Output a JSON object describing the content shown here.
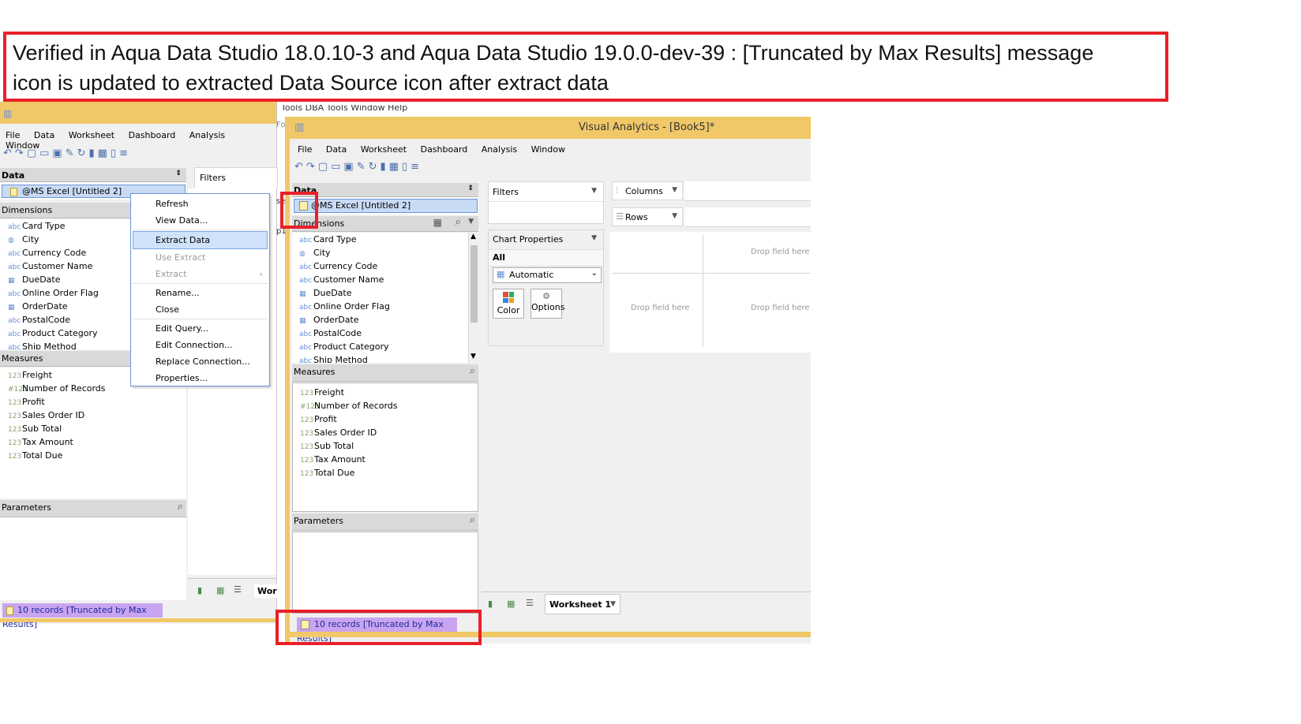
{
  "banner": {
    "line1": "Verified in Aqua Data Studio 18.0.10-3 and Aqua Data Studio 19.0.0-dev-39 : [Truncated by Max Results] message",
    "line2": "icon is updated to extracted Data Source icon after extract data"
  },
  "left_window": {
    "menu": [
      "File",
      "Data",
      "Worksheet",
      "Dashboard",
      "Analysis",
      "Window"
    ],
    "data_header": "Data",
    "datasource": "@MS Excel [Untitled 2]",
    "filters_label": "Filters",
    "dimensions_header": "Dimensions",
    "dimensions": [
      "Card Type",
      "City",
      "Currency Code",
      "Customer Name",
      "DueDate",
      "Online Order Flag",
      "OrderDate",
      "PostalCode",
      "Product Category",
      "Ship Method"
    ],
    "dimension_types": [
      "abc",
      "geo",
      "abc",
      "abc",
      "date",
      "abc",
      "date",
      "abc",
      "abc",
      "abc"
    ],
    "measures_header": "Measures",
    "measures": [
      "Freight",
      "Number of Records",
      "Profit",
      "Sales Order ID",
      "Sub Total",
      "Tax Amount",
      "Total Due"
    ],
    "parameters_header": "Parameters",
    "status": "10 records [Truncated by Max Results]",
    "tab_partial": "Wor",
    "side_partial_1": "Fo",
    "side_partial_2": "se",
    "side_partial_3": "p1",
    "context_menu": [
      {
        "label": "Refresh",
        "state": "normal"
      },
      {
        "label": "View Data...",
        "state": "normal"
      },
      {
        "sep": true
      },
      {
        "label": "Extract Data",
        "state": "highlighted"
      },
      {
        "label": "Use Extract",
        "state": "disabled"
      },
      {
        "label": "Extract",
        "state": "disabled",
        "submenu": true
      },
      {
        "sep": true
      },
      {
        "label": "Rename...",
        "state": "normal"
      },
      {
        "label": "Close",
        "state": "normal"
      },
      {
        "sep": true
      },
      {
        "label": "Edit Query...",
        "state": "normal"
      },
      {
        "label": "Edit Connection...",
        "state": "normal"
      },
      {
        "label": "Replace Connection...",
        "state": "normal"
      },
      {
        "label": "Properties...",
        "state": "normal"
      }
    ]
  },
  "right_window": {
    "title": "Visual Analytics - [Book5]*",
    "partial_menu": "Tools    DBA Tools    Window    Help",
    "menu": [
      "File",
      "Data",
      "Worksheet",
      "Dashboard",
      "Analysis",
      "Window"
    ],
    "data_header": "Data",
    "datasource": "@MS Excel [Untitled 2]",
    "dimensions_header": "Dimensions",
    "dimensions": [
      "Card Type",
      "City",
      "Currency Code",
      "Customer Name",
      "DueDate",
      "Online Order Flag",
      "OrderDate",
      "PostalCode",
      "Product Category",
      "Ship Method"
    ],
    "dimension_types": [
      "abc",
      "geo",
      "abc",
      "abc",
      "date",
      "abc",
      "date",
      "abc",
      "abc",
      "abc"
    ],
    "measures_header": "Measures",
    "measures": [
      "Freight",
      "Number of Records",
      "Profit",
      "Sales Order ID",
      "Sub Total",
      "Tax Amount",
      "Total Due"
    ],
    "parameters_header": "Parameters",
    "filters_label": "Filters",
    "columns_label": "Columns",
    "rows_label": "Rows",
    "chart_properties_label": "Chart Properties",
    "all_label": "All",
    "mark_type": "Automatic",
    "color_button": "Color",
    "options_button": "Options",
    "drop_field": "Drop field here",
    "worksheet_tab": "Worksheet 1",
    "status": "10 records [Truncated by Max Results]"
  },
  "colors": {
    "title_bar": "#f0c868",
    "status_bg": "#c9a4f0",
    "highlight": "#e8202a",
    "selection": "#c9daf5"
  }
}
